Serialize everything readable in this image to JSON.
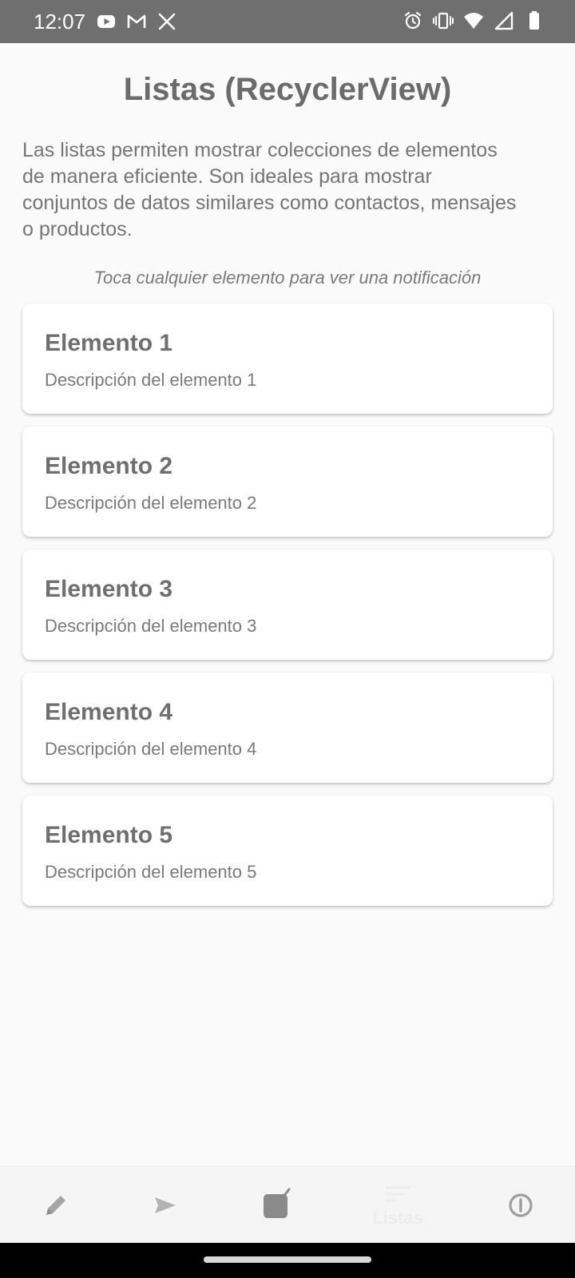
{
  "status_bar": {
    "time": "12:07",
    "left_icons": [
      "youtube-icon",
      "gmail-icon",
      "x-icon"
    ],
    "right_icons": [
      "alarm-icon",
      "vibrate-icon",
      "wifi-icon",
      "signal-icon",
      "battery-icon"
    ]
  },
  "page": {
    "title": "Listas (RecyclerView)",
    "description": "Las listas permiten mostrar colecciones de elementos de manera eficiente. Son ideales para mostrar conjuntos de datos similares como contactos, mensajes o productos.",
    "hint": "Toca cualquier elemento para ver una notificación"
  },
  "list": {
    "items": [
      {
        "title": "Elemento 1",
        "description": "Descripción del elemento 1"
      },
      {
        "title": "Elemento 2",
        "description": "Descripción del elemento 2"
      },
      {
        "title": "Elemento 3",
        "description": "Descripción del elemento 3"
      },
      {
        "title": "Elemento 4",
        "description": "Descripción del elemento 4"
      },
      {
        "title": "Elemento 5",
        "description": "Descripción del elemento 5"
      }
    ]
  },
  "bottom_nav": {
    "items": [
      {
        "icon": "pencil-icon",
        "label": ""
      },
      {
        "icon": "send-icon",
        "label": ""
      },
      {
        "icon": "checkbox-icon",
        "label": ""
      },
      {
        "icon": "list-icon",
        "label": "Listas",
        "selected": true
      },
      {
        "icon": "info-icon",
        "label": ""
      }
    ]
  },
  "colors": {
    "status_bar": "#6f6f6f",
    "background": "#fafafa",
    "card": "#ffffff",
    "title_text": "#6b6b6b",
    "body_text": "#757575",
    "nav_icon": "#a6a6a6",
    "nav_selected": "#ececec"
  }
}
